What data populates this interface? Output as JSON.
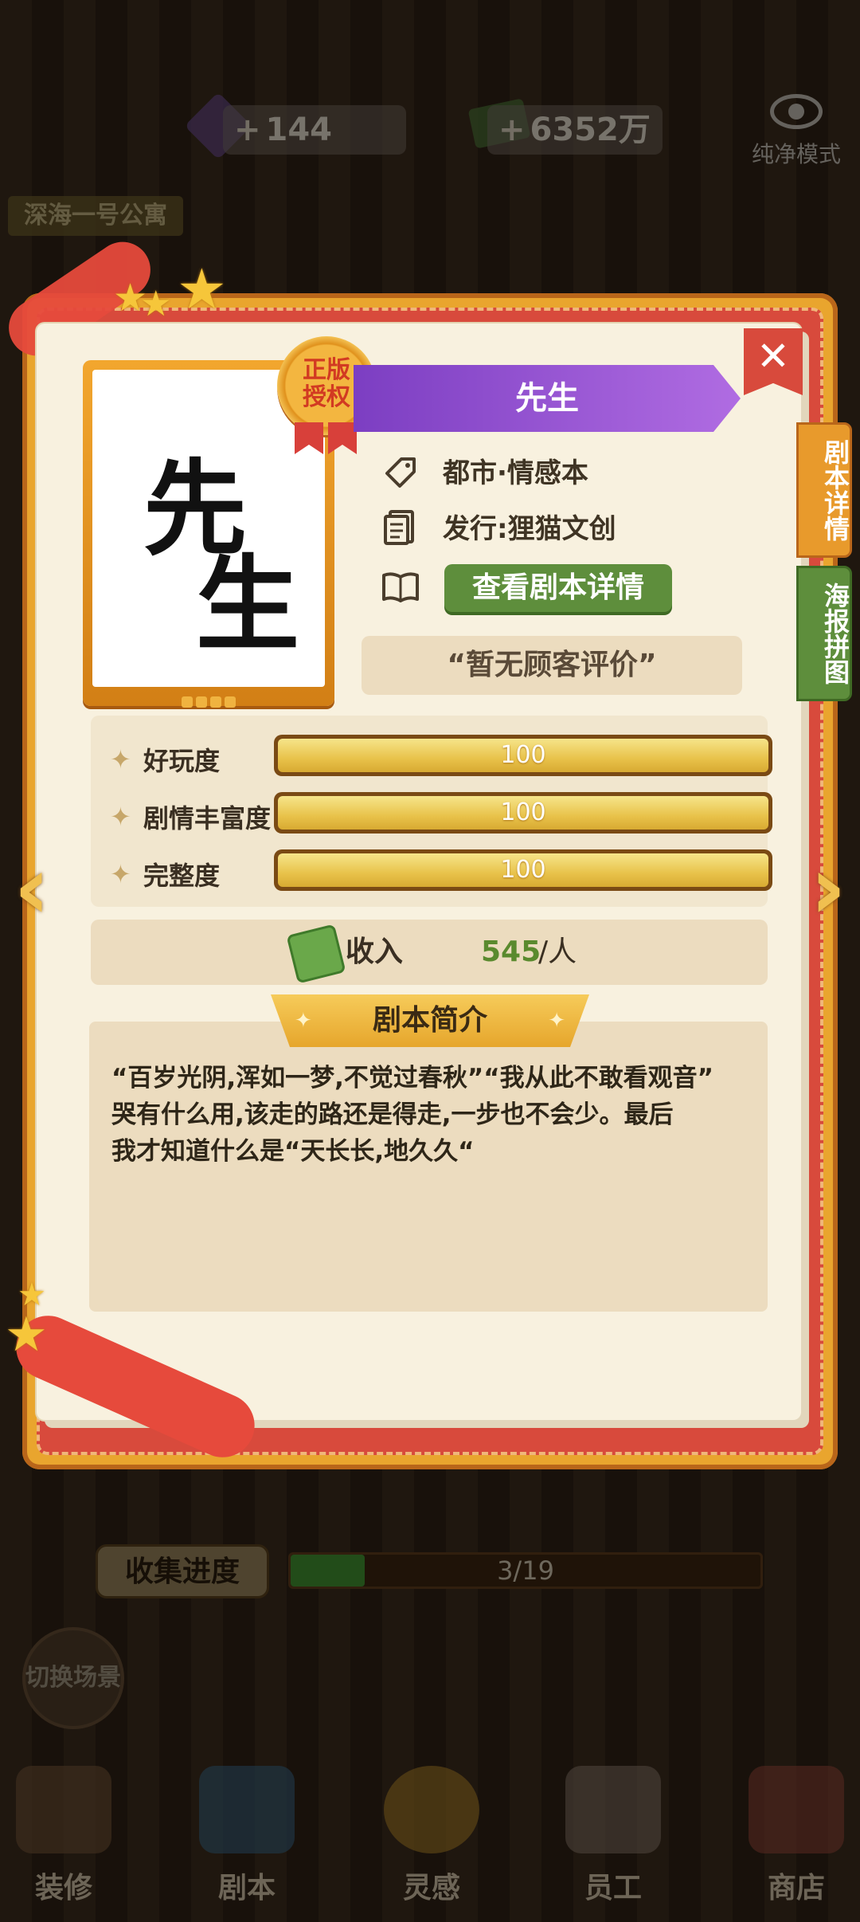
{
  "hud": {
    "gems": "144",
    "money": "6352万",
    "plus": "+",
    "pure_mode_label": "纯净模式",
    "apartment_label": "深海一号公寓"
  },
  "modal": {
    "seal": [
      "正版",
      "授权"
    ],
    "title": "先生",
    "poster_chars": [
      "先",
      "生"
    ],
    "genre": "都市·情感本",
    "publisher": "发行:狸猫文创",
    "detail_button": "查看剧本详情",
    "review": "“暂无顾客评价”",
    "close": "✕",
    "side_tabs": [
      "剧本详情",
      "海报拼图"
    ],
    "stats": [
      {
        "label": "好玩度",
        "value": "100",
        "fraction": 1.0
      },
      {
        "label": "剧情丰富度",
        "value": "100",
        "fraction": 1.0
      },
      {
        "label": "完整度",
        "value": "100",
        "fraction": 1.0
      }
    ],
    "income_label": "收入",
    "income_value": "545",
    "income_unit": "/人",
    "synopsis_title": "剧本简介",
    "synopsis_text": "“百岁光阴,浑如一梦,不觉过春秋”“我从此不敢看观音”\n哭有什么用,该走的路还是得走,一步也不会少。最后\n我才知道什么是“天长长,地久久“"
  },
  "collection": {
    "label": "收集进度",
    "text": "3/19",
    "fraction": 0.158
  },
  "switch_scene": "切换场景",
  "bottom_nav": [
    {
      "label": "装修",
      "color": "#7a5a3a"
    },
    {
      "label": "剧本",
      "color": "#3a6a8a"
    },
    {
      "label": "灵感",
      "color": "#b88a2a"
    },
    {
      "label": "员工",
      "color": "#8a7a6a"
    },
    {
      "label": "商店",
      "color": "#9a4a3a"
    }
  ],
  "colors": {
    "frame_orange": "#e9a52e",
    "frame_red": "#d84a3c",
    "paper": "#f8f1df",
    "title_purple": "#9254d4",
    "button_green": "#5e8e3c",
    "bar_gold": "#e8c24a"
  }
}
